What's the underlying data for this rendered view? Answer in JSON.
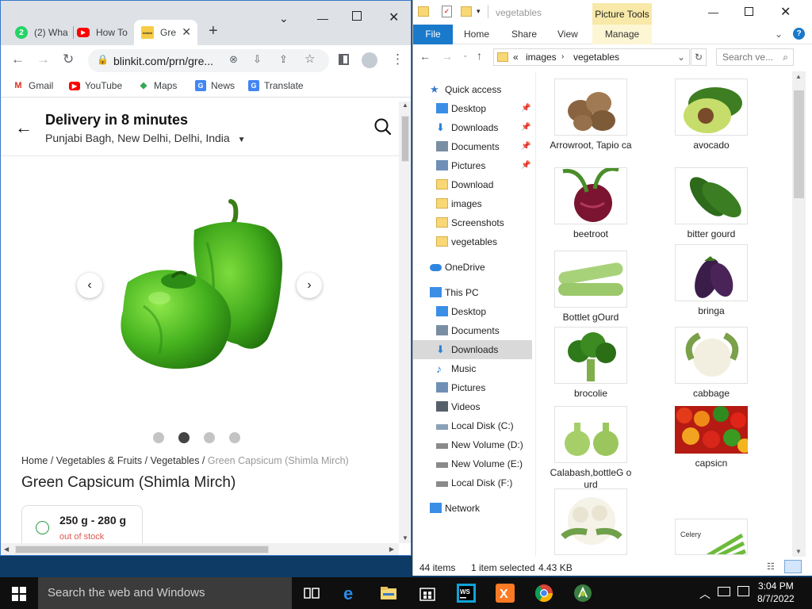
{
  "chrome": {
    "tabs": [
      {
        "label": "(2) Wha",
        "icon": "whatsapp-icon",
        "badge": "2"
      },
      {
        "label": "How To",
        "icon": "youtube-icon"
      },
      {
        "label": "Gre",
        "icon": "blinkit-icon",
        "badge": "blinkit",
        "active": true
      }
    ],
    "new_tab": "+",
    "url": "blinkit.com/prn/gre...",
    "bookmarks": [
      {
        "label": "Gmail",
        "icon": "gmail-icon",
        "glyph": "M"
      },
      {
        "label": "YouTube",
        "icon": "youtube-icon",
        "glyph": "▶"
      },
      {
        "label": "Maps",
        "icon": "maps-icon",
        "glyph": "◆"
      },
      {
        "label": "News",
        "icon": "news-icon",
        "glyph": "G"
      },
      {
        "label": "Translate",
        "icon": "translate-icon",
        "glyph": "G"
      }
    ],
    "page": {
      "delivery_title": "Delivery in 8 minutes",
      "location": "Punjabi Bagh, New Delhi, Delhi, India",
      "breadcrumb": {
        "items": [
          "Home",
          "Vegetables & Fruits",
          "Vegetables"
        ],
        "current": "Green Capsicum (Shimla Mirch)",
        "sep": " / "
      },
      "product_title": "Green Capsicum (Shimla Mirch)",
      "variant": {
        "weight": "250 g - 280 g",
        "stock": "out of stock"
      },
      "carousel": {
        "slides": 4,
        "active_index": 1
      }
    },
    "scrollbars": {
      "vertical_position": 0.03,
      "horizontal_position": 0.0
    }
  },
  "explorer": {
    "title": "vegetables",
    "picture_tools": "Picture Tools",
    "ribbon_tabs": [
      "File",
      "Home",
      "Share",
      "View",
      "Manage"
    ],
    "path": [
      "images",
      "vegetables"
    ],
    "path_prefix": "«",
    "search_placeholder": "Search ve...",
    "nav": [
      {
        "label": "Quick access",
        "icon": "star-icon",
        "level": 0
      },
      {
        "label": "Desktop",
        "icon": "desktop-icon",
        "level": 1,
        "pinned": true
      },
      {
        "label": "Downloads",
        "icon": "download-arrow-icon",
        "level": 1,
        "pinned": true
      },
      {
        "label": "Documents",
        "icon": "documents-icon",
        "level": 1,
        "pinned": true
      },
      {
        "label": "Pictures",
        "icon": "pictures-icon",
        "level": 1,
        "pinned": true
      },
      {
        "label": "Download",
        "icon": "folder-icon",
        "level": 1
      },
      {
        "label": "images",
        "icon": "folder-icon",
        "level": 1
      },
      {
        "label": "Screenshots",
        "icon": "folder-icon",
        "level": 1
      },
      {
        "label": "vegetables",
        "icon": "folder-icon",
        "level": 1
      },
      {
        "label": "OneDrive",
        "icon": "onedrive-icon",
        "level": 0
      },
      {
        "label": "This PC",
        "icon": "pc-icon",
        "level": 0
      },
      {
        "label": "Desktop",
        "icon": "desktop-icon",
        "level": 1
      },
      {
        "label": "Documents",
        "icon": "documents-icon",
        "level": 1
      },
      {
        "label": "Downloads",
        "icon": "download-arrow-icon",
        "level": 1,
        "selected": true
      },
      {
        "label": "Music",
        "icon": "music-icon",
        "level": 1
      },
      {
        "label": "Pictures",
        "icon": "pictures-icon",
        "level": 1
      },
      {
        "label": "Videos",
        "icon": "videos-icon",
        "level": 1
      },
      {
        "label": "Local Disk (C:)",
        "icon": "windows-drive-icon",
        "level": 1
      },
      {
        "label": "New Volume (D:)",
        "icon": "drive-icon",
        "level": 1
      },
      {
        "label": "New Volume (E:)",
        "icon": "drive-icon",
        "level": 1
      },
      {
        "label": "Local Disk (F:)",
        "icon": "drive-icon",
        "level": 1
      },
      {
        "label": "Network",
        "icon": "network-icon",
        "level": 0
      }
    ],
    "files": [
      {
        "label": "Arrowroot, Tapio ca",
        "kind": "arrowroot"
      },
      {
        "label": "avocado",
        "kind": "avocado"
      },
      {
        "label": "beetroot",
        "kind": "beetroot"
      },
      {
        "label": "bitter gourd",
        "kind": "bittergourd"
      },
      {
        "label": "Bottlet gOurd",
        "kind": "bottlegourd"
      },
      {
        "label": "bringa",
        "kind": "brinjal"
      },
      {
        "label": "brocolie",
        "kind": "broccoli"
      },
      {
        "label": "cabbage",
        "kind": "cauliflower"
      },
      {
        "label": "Calabash,bottleG ourd",
        "kind": "calabash"
      },
      {
        "label": "capsicn",
        "kind": "capsicum"
      },
      {
        "label": "",
        "kind": "cauliflower2"
      },
      {
        "label": "Celery",
        "kind": "celery"
      }
    ],
    "status": {
      "count": "44 items",
      "selected": "1 item selected",
      "size": "4.43 KB"
    }
  },
  "taskbar": {
    "search_placeholder": "Search the web and Windows",
    "apps": [
      "task-view-icon",
      "edge-icon",
      "file-explorer-icon",
      "store-icon",
      "webstorm-icon",
      "xampp-icon",
      "chrome-icon",
      "android-studio-icon"
    ],
    "time": "3:04 PM",
    "date": "8/7/2022"
  },
  "colors": {
    "chrome_frame": "#dee1e6",
    "explorer_file_tab": "#1979ca",
    "picture_tools": "#f8e9a8",
    "out_of_stock": "#e1564c",
    "capsicum_green": "#3fa81b",
    "taskbar": "#0f0f0f"
  }
}
